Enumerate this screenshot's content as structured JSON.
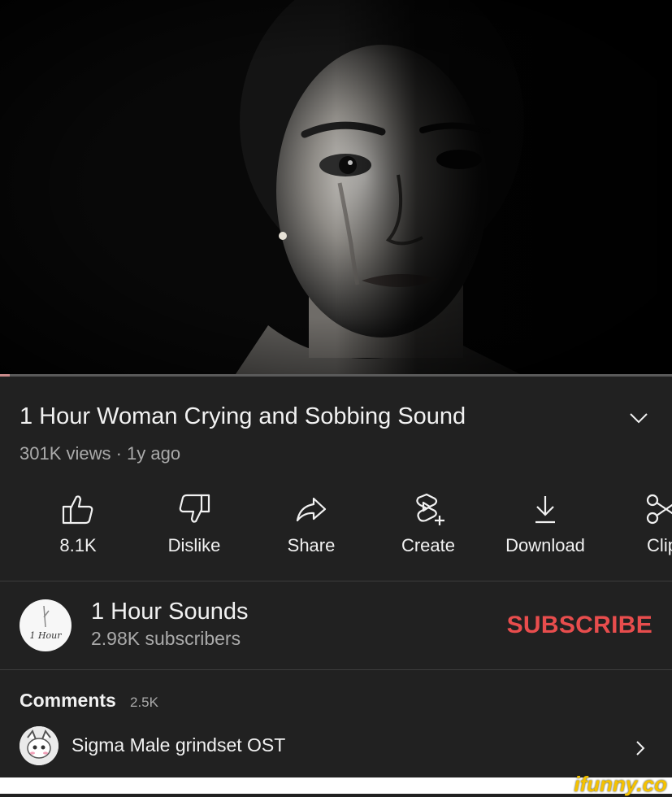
{
  "video": {
    "thumbnail_icon": "crying-woman-portrait",
    "progress_fraction": 0.014
  },
  "title": "1 Hour Woman Crying and Sobbing Sound",
  "meta": "301K views · 1y ago",
  "actions": [
    {
      "icon": "thumbs-up-icon",
      "label": "8.1K"
    },
    {
      "icon": "thumbs-down-icon",
      "label": "Dislike"
    },
    {
      "icon": "share-icon",
      "label": "Share"
    },
    {
      "icon": "create-icon",
      "label": "Create"
    },
    {
      "icon": "download-icon",
      "label": "Download"
    },
    {
      "icon": "clip-icon",
      "label": "Clip"
    }
  ],
  "channel": {
    "name": "1 Hour Sounds",
    "subscribers": "2.98K subscribers",
    "avatar_text": "1 Hour",
    "subscribe_label": "SUBSCRIBE",
    "subscribe_color": "#e84d4d"
  },
  "comments": {
    "label": "Comments",
    "count": "2.5K",
    "first_comment": "Sigma Male grindset OST"
  },
  "watermark": "ifunny.co",
  "colors": {
    "background": "#212121",
    "accent_watermark": "#f5c200"
  }
}
